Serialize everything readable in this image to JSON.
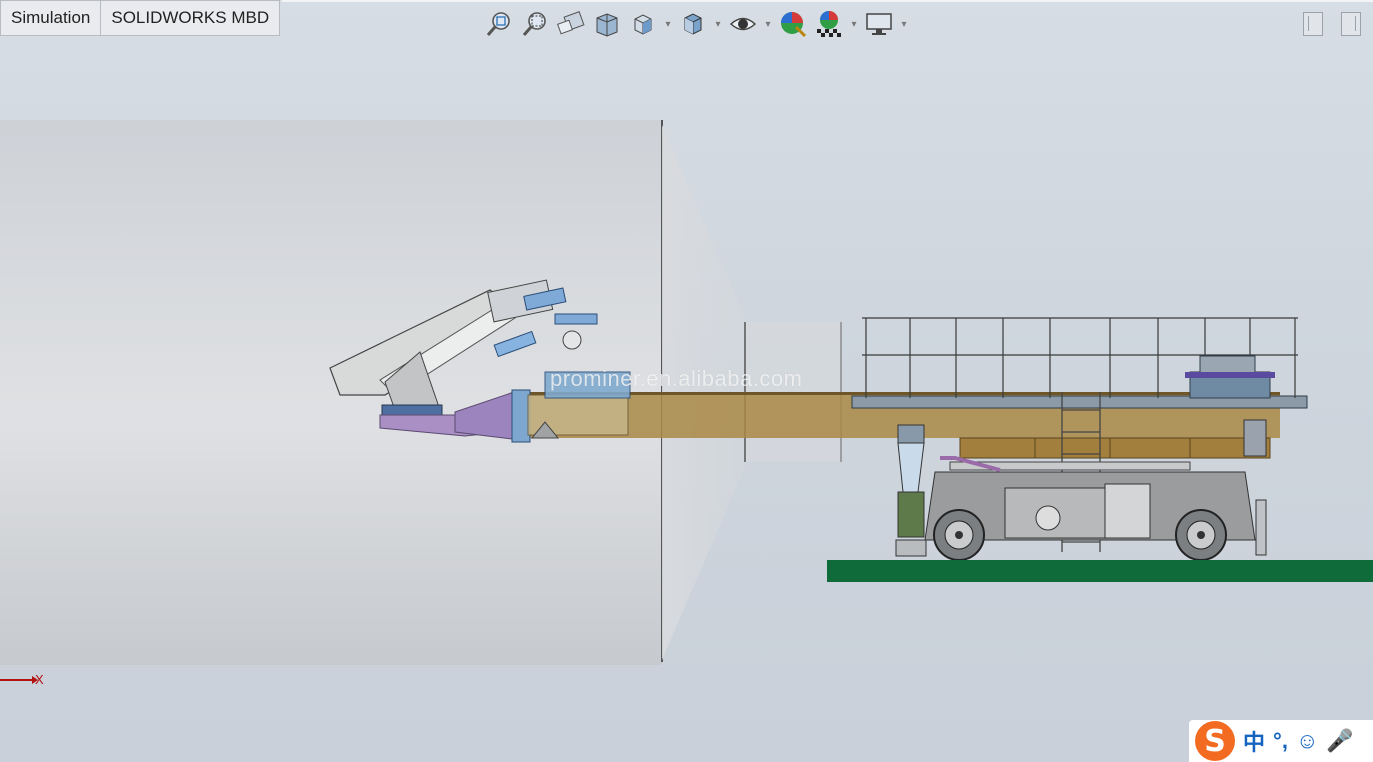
{
  "tabs": [
    {
      "label": "Simulation"
    },
    {
      "label": "SOLIDWORKS MBD"
    }
  ],
  "toolbar": {
    "icons": [
      "zoom-to-fit-icon",
      "zoom-to-area-icon",
      "previous-view-icon",
      "section-view-icon",
      "view-orientation-icon",
      "display-style-icon",
      "hide-show-items-icon",
      "edit-appearance-icon",
      "apply-scene-icon",
      "view-settings-icon"
    ]
  },
  "viewport": {
    "watermark": "prominer.en.alibaba.com",
    "axis_label": "X"
  },
  "ime": {
    "logo": "S",
    "mode": "中",
    "punct": "°,",
    "emoji": "☺",
    "mic": "🎤"
  },
  "colors": {
    "background": "#cfd6de",
    "beam": "#9c7b3c",
    "ground": "#0f6b3a",
    "arm_purple": "#a889c2",
    "ime_orange": "#f36b21",
    "axis_red": "#b31212"
  }
}
